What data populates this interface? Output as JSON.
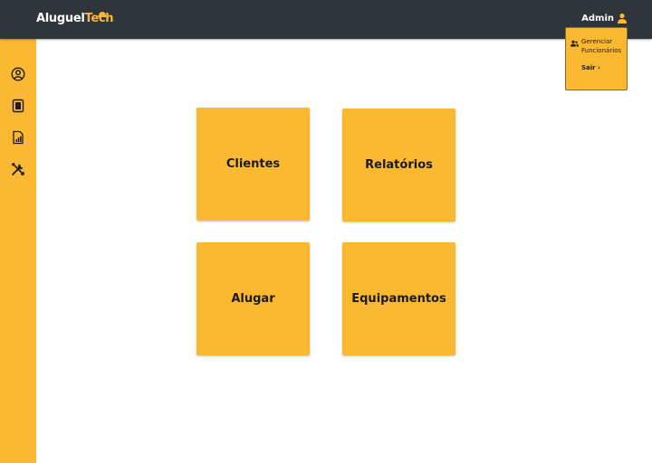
{
  "header": {
    "logo_part1": "Aluguel",
    "logo_part2": "Tech",
    "user_label": "Admin",
    "user_icon": "user-icon"
  },
  "sidebar": {
    "items": [
      {
        "icon": "user-circle-icon"
      },
      {
        "icon": "document-icon"
      },
      {
        "icon": "report-chart-icon"
      },
      {
        "icon": "tools-icon"
      }
    ]
  },
  "user_menu": {
    "manage_line1": "Gerenciar",
    "manage_line2": "Funcionários",
    "manage_icon": "users-icon",
    "exit_label": "Sair ›"
  },
  "tiles": [
    {
      "label": "Clientes"
    },
    {
      "label": "Relatórios"
    },
    {
      "label": "Alugar"
    },
    {
      "label": "Equipamentos"
    }
  ],
  "colors": {
    "accent": "#fbb932",
    "header_bg": "#30343b",
    "text_dark": "#1a1a1a"
  }
}
